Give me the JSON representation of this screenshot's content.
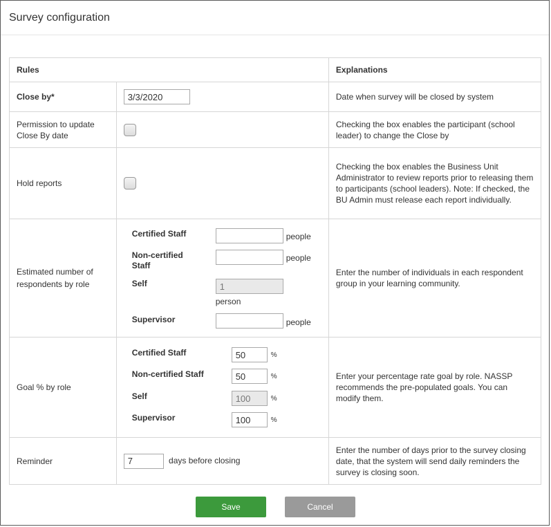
{
  "title": "Survey configuration",
  "table": {
    "header_rules": "Rules",
    "header_explanations": "Explanations",
    "close_by": {
      "label": "Close by*",
      "value": "3/3/2020",
      "explanation": "Date when survey will be closed by system"
    },
    "permission": {
      "label": "Permission to update Close By date",
      "checked": false,
      "explanation": "Checking the box enables the participant (school leader) to change the Close by"
    },
    "hold_reports": {
      "label": "Hold reports",
      "checked": false,
      "explanation": "Checking the box enables the Business Unit Administrator to review reports prior to releasing them to participants (school leaders). Note: If checked, the BU Admin must release each report individually."
    },
    "estimated": {
      "label": "Estimated number of respondents by role",
      "explanation": "Enter the number of individuals in each respondent group in your learning community.",
      "roles": [
        {
          "name": "Certified Staff",
          "value": "",
          "unit": "people"
        },
        {
          "name": "Non-certified Staff",
          "value": "",
          "unit": "people"
        },
        {
          "name": "Self",
          "value": "1",
          "unit": "person"
        },
        {
          "name": "Supervisor",
          "value": "",
          "unit": "people"
        }
      ]
    },
    "goal": {
      "label": "Goal % by role",
      "explanation": "Enter your percentage rate goal by role. NASSP recommends the pre-populated goals. You can modify them.",
      "roles": [
        {
          "name": "Certified Staff",
          "value": "50",
          "unit": "%"
        },
        {
          "name": "Non-certified Staff",
          "value": "50",
          "unit": "%"
        },
        {
          "name": "Self",
          "value": "100",
          "unit": "%"
        },
        {
          "name": "Supervisor",
          "value": "100",
          "unit": "%"
        }
      ]
    },
    "reminder": {
      "label": "Reminder",
      "value": "7",
      "suffix": "days before closing",
      "explanation": "Enter the number of days prior to the survey closing date, that the system will send daily reminders the survey is closing soon."
    }
  },
  "buttons": {
    "save": "Save",
    "cancel": "Cancel"
  }
}
